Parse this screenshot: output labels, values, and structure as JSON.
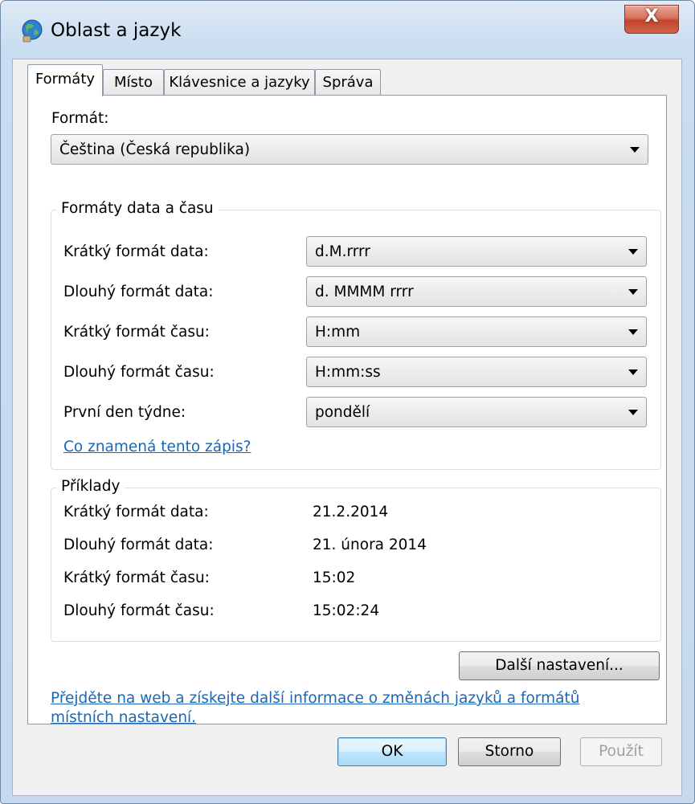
{
  "window": {
    "title": "Oblast a jazyk",
    "close_label": "X"
  },
  "tabs": [
    "Formáty",
    "Místo",
    "Klávesnice a jazyky",
    "Správa"
  ],
  "format": {
    "label": "Formát:",
    "value": "Čeština (Česká republika)"
  },
  "datetime_group": {
    "title": "Formáty data a času",
    "rows": [
      {
        "label": "Krátký formát data:",
        "value": "d.M.rrrr"
      },
      {
        "label": "Dlouhý formát data:",
        "value": "d. MMMM rrrr"
      },
      {
        "label": "Krátký formát času:",
        "value": "H:mm"
      },
      {
        "label": "Dlouhý formát času:",
        "value": "H:mm:ss"
      },
      {
        "label": "První den týdne:",
        "value": "pondělí"
      }
    ],
    "help_link": "Co znamená tento zápis?"
  },
  "examples_group": {
    "title": "Příklady",
    "rows": [
      {
        "label": "Krátký formát data:",
        "value": "21.2.2014"
      },
      {
        "label": "Dlouhý formát data:",
        "value": "21. února 2014"
      },
      {
        "label": "Krátký formát času:",
        "value": "15:02"
      },
      {
        "label": "Dlouhý formát času:",
        "value": "15:02:24"
      }
    ]
  },
  "more_settings_label": "Další nastavení...",
  "web_link": {
    "line1": "Přejděte na web a získejte další informace o změnách jazyků a formátů",
    "line2": "místních nastavení."
  },
  "buttons": {
    "ok": "OK",
    "cancel": "Storno",
    "apply": "Použít"
  }
}
